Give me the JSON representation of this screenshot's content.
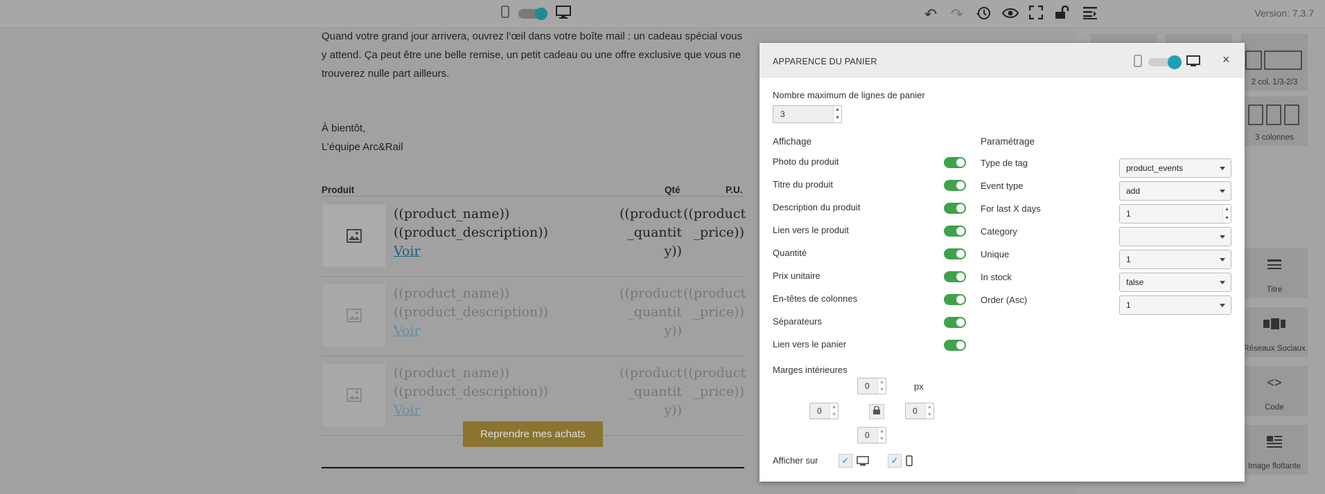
{
  "topbar": {
    "version": "Version: 7.3.7",
    "icons": [
      "mobile-icon",
      "desktop-icon",
      "undo-icon",
      "redo-icon",
      "history-icon",
      "preview-eye-icon",
      "fullscreen-icon",
      "unlock-icon",
      "layout-panel-icon"
    ]
  },
  "email": {
    "para1": "Quand votre grand jour arrivera, ouvrez l’œil dans votre boîte mail : un cadeau spécial vous y attend. Ça peut être une belle remise, un petit cadeau ou une offre exclusive que vous ne trouverez nulle part ailleurs.",
    "signoff1": "À bientôt,",
    "signoff2": "L’équipe Arc&Rail",
    "table_head": {
      "product": "Produit",
      "qty": "Qté",
      "price": "P.U."
    },
    "rows": [
      {
        "name": "((product_name))",
        "desc": "((product_description))",
        "link": "Voir",
        "qty1": "((product",
        "qty2": "_quantit",
        "qty3": "y))",
        "price1": "((product",
        "price2": "_price))"
      },
      {
        "name": "((product_name))",
        "desc": "((product_description))",
        "link": "Voir",
        "qty1": "((product",
        "qty2": "_quantit",
        "qty3": "y))",
        "price1": "((product",
        "price2": "_price))"
      },
      {
        "name": "((product_name))",
        "desc": "((product_description))",
        "link": "Voir",
        "qty1": "((product",
        "qty2": "_quantit",
        "qty3": "y))",
        "price1": "((product",
        "price2": "_price))"
      }
    ],
    "cta": "Reprendre mes achats"
  },
  "blocks": {
    "col_2_1_3": "2 col. 1/3-2/3",
    "col_3": "3 colonnes",
    "title": "Titre",
    "social": "Réseaux Sociaux",
    "code": "Code",
    "floating_image": "Image flottante"
  },
  "modal": {
    "title": "APPARENCE DU PANIER",
    "max_lines_label": "Nombre maximum de lignes de panier",
    "max_lines_value": "3",
    "display_heading": "Affichage",
    "display_options": [
      {
        "label": "Photo du produit",
        "on": true
      },
      {
        "label": "Titre du produit",
        "on": true
      },
      {
        "label": "Description du produit",
        "on": true
      },
      {
        "label": "Lien vers le produit",
        "on": true
      },
      {
        "label": "Quantité",
        "on": true
      },
      {
        "label": "Prix unitaire",
        "on": true
      },
      {
        "label": "En-têtes de colonnes",
        "on": true
      },
      {
        "label": "Séparateurs",
        "on": true
      },
      {
        "label": "Lien vers le panier",
        "on": true
      }
    ],
    "settings_heading": "Paramétrage",
    "settings": [
      {
        "label": "Type de tag",
        "value": "product_events",
        "kind": "select"
      },
      {
        "label": "Event type",
        "value": "add",
        "kind": "select"
      },
      {
        "label": "For last X days",
        "value": "1",
        "kind": "number"
      },
      {
        "label": "Category",
        "value": "",
        "kind": "select"
      },
      {
        "label": "Unique",
        "value": "1",
        "kind": "select"
      },
      {
        "label": "In stock",
        "value": "false",
        "kind": "select"
      },
      {
        "label": "Order (Asc)",
        "value": "1",
        "kind": "select"
      }
    ],
    "padding_label": "Marges intérieures",
    "padding_unit": "px",
    "padding": {
      "top": "0",
      "left": "0",
      "right": "0",
      "bottom": "0"
    },
    "show_on_label": "Afficher sur",
    "show_on": {
      "desktop": true,
      "mobile": true
    }
  },
  "colors": {
    "toggle_on": "#3fa34d",
    "accent": "#1aa3b4",
    "cta_bg": "#8a7430"
  }
}
